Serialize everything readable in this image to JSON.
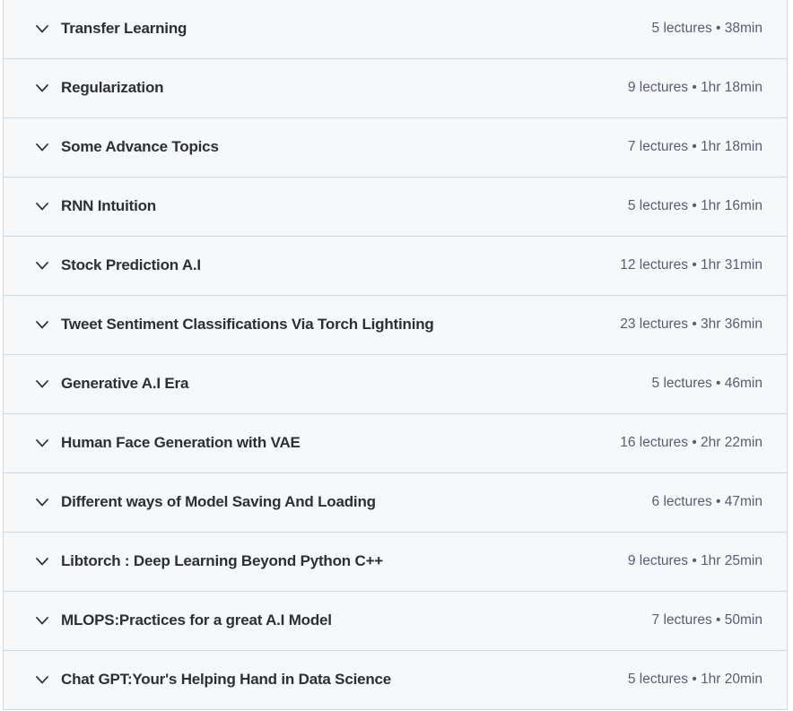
{
  "curriculum": {
    "chevron_icon": "chevron-down-icon",
    "separator": "•",
    "lectures_word": "lectures",
    "colors": {
      "row_background": "#f7f8fa",
      "border": "#d1d7dc",
      "title_text": "#2d2f31",
      "meta_text": "#595c73",
      "page_background": "#ffffff"
    },
    "sections": [
      {
        "title": "Transfer Learning",
        "meta": "5 lectures • 38min",
        "lectures": "5 lectures",
        "duration": "38min"
      },
      {
        "title": "Regularization",
        "meta": "9 lectures • 1hr 18min",
        "lectures": "9 lectures",
        "duration": "1hr 18min"
      },
      {
        "title": "Some Advance Topics",
        "meta": "7 lectures • 1hr 18min",
        "lectures": "7 lectures",
        "duration": "1hr 18min"
      },
      {
        "title": "RNN Intuition",
        "meta": "5 lectures • 1hr 16min",
        "lectures": "5 lectures",
        "duration": "1hr 16min"
      },
      {
        "title": "Stock Prediction A.I",
        "meta": "12 lectures • 1hr 31min",
        "lectures": "12 lectures",
        "duration": "1hr 31min"
      },
      {
        "title": "Tweet Sentiment Classifications Via Torch Lightining",
        "meta": "23 lectures • 3hr 36min",
        "lectures": "23 lectures",
        "duration": "3hr 36min"
      },
      {
        "title": "Generative A.I Era",
        "meta": "5 lectures • 46min",
        "lectures": "5 lectures",
        "duration": "46min"
      },
      {
        "title": "Human Face Generation with VAE",
        "meta": "16 lectures • 2hr 22min",
        "lectures": "16 lectures",
        "duration": "2hr 22min"
      },
      {
        "title": "Different ways of Model Saving And Loading",
        "meta": "6 lectures • 47min",
        "lectures": "6 lectures",
        "duration": "47min"
      },
      {
        "title": "Libtorch : Deep Learning Beyond Python C++",
        "meta": "9 lectures • 1hr 25min",
        "lectures": "9 lectures",
        "duration": "1hr 25min"
      },
      {
        "title": "MLOPS:Practices for a great A.I Model",
        "meta": "7 lectures • 50min",
        "lectures": "7 lectures",
        "duration": "50min"
      },
      {
        "title": "Chat GPT:Your's Helping Hand in Data Science",
        "meta": "5 lectures • 1hr 20min",
        "lectures": "5 lectures",
        "duration": "1hr 20min"
      }
    ]
  }
}
